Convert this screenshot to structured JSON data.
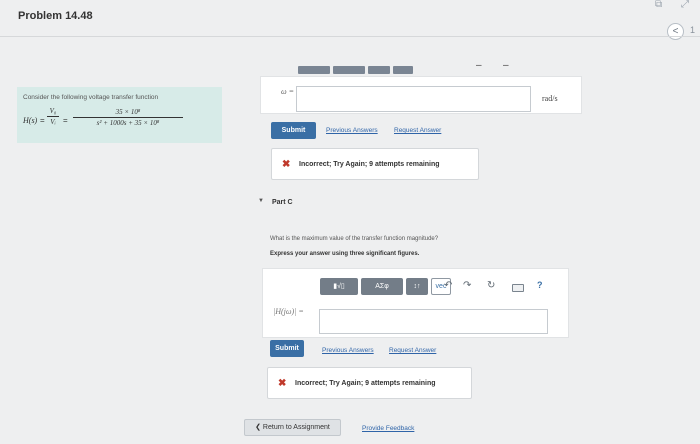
{
  "header": {
    "title": "Problem 14.48",
    "nav_prev_glyph": "<",
    "nav_next_glyph": "1"
  },
  "problem": {
    "intro": "Consider the following voltage transfer function",
    "tf_lhs": "H(s)",
    "equals": "=",
    "frac1_num": "V₀",
    "frac1_den": "Vᵢ",
    "frac2_num": "35 × 10⁸",
    "frac2_den": "s² + 1000s + 35 × 10⁸"
  },
  "part_b": {
    "omega_label": "ω =",
    "omega_value": "",
    "unit": "rad/s",
    "submit_label": "Submit",
    "previous_answers": "Previous Answers",
    "request_answer": "Request Answer",
    "feedback": "Incorrect; Try Again; 9 attempts remaining"
  },
  "part_c": {
    "label": "Part C",
    "question": "What is the maximum value of the transfer function magnitude?",
    "instruction": "Express your answer using three significant figures.",
    "toolbar": {
      "templates": "▮√▯",
      "greek": "ΑΣφ",
      "subsup": "↕↑",
      "vec": "vec",
      "help": "?"
    },
    "input_label": "|H(jω)| =",
    "input_value": "",
    "submit_label": "Submit",
    "previous_answers": "Previous Answers",
    "request_answer": "Request Answer",
    "feedback": "Incorrect; Try Again; 9 attempts remaining"
  },
  "footer": {
    "return_label": "❮ Return to Assignment",
    "feedback_label": "Provide Feedback"
  }
}
